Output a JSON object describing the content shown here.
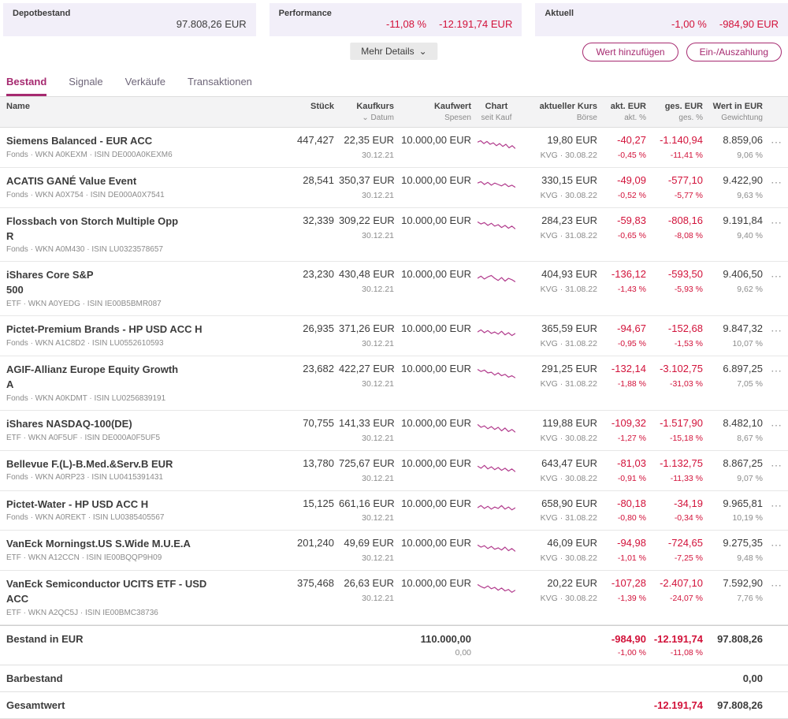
{
  "colors": {
    "accent": "#a62a70",
    "negative": "#d2123a",
    "spark": "#b13a8c",
    "card_bg": "#f2eff9"
  },
  "icons": {
    "caret_down": "⌄",
    "sort_caret": "⌄",
    "row_menu": "⋯"
  },
  "summary": {
    "cards": [
      {
        "label": "Depotbestand",
        "value": "97.808,26 EUR"
      },
      {
        "label": "Performance",
        "pct": "-11,08 %",
        "value": "-12.191,74 EUR"
      },
      {
        "label": "Aktuell",
        "pct": "-1,00 %",
        "value": "-984,90 EUR"
      }
    ]
  },
  "actions": {
    "more_details": "Mehr Details",
    "add_value": "Wert hinzufügen",
    "deposit": "Ein-/Auszahlung"
  },
  "tabs": [
    {
      "label": "Bestand"
    },
    {
      "label": "Signale"
    },
    {
      "label": "Verkäufe"
    },
    {
      "label": "Transaktionen"
    }
  ],
  "table": {
    "headers": {
      "name": "Name",
      "stueck": "Stück",
      "kaufkurs": "Kaufkurs",
      "kaufkurs_sub": "Datum",
      "kaufwert": "Kaufwert",
      "kaufwert_sub": "Spesen",
      "chart": "Chart",
      "chart_sub": "seit Kauf",
      "kurs": "aktueller Kurs",
      "kurs_sub": "Börse",
      "akt": "akt. EUR",
      "akt_sub": "akt. %",
      "ges": "ges. EUR",
      "ges_sub": "ges. %",
      "wert": "Wert in EUR",
      "wert_sub": "Gewichtung"
    },
    "rows": [
      {
        "name": "Siemens Balanced - EUR ACC",
        "meta": "Fonds · WKN A0KEXM · ISIN DE000A0KEXM6",
        "stueck": "447,427",
        "kaufkurs": "22,35 EUR",
        "kaufdatum": "30.12.21",
        "kaufwert": "10.000,00 EUR",
        "kurs": "19,80 EUR",
        "kursmeta": "KVG · 30.08.22",
        "akt": "-40,27",
        "akt_pct": "-0,45 %",
        "ges": "-1.140,94",
        "ges_pct": "-11,41 %",
        "wert": "8.859,06",
        "gew": "9,06 %",
        "spark": [
          0.35,
          0.25,
          0.45,
          0.3,
          0.5,
          0.4,
          0.6,
          0.45,
          0.65,
          0.5,
          0.75,
          0.6,
          0.8
        ]
      },
      {
        "name": "ACATIS GANÉ Value Event",
        "meta": "Fonds · WKN A0X754 · ISIN DE000A0X7541",
        "stueck": "28,541",
        "kaufkurs": "350,37 EUR",
        "kaufdatum": "30.12.21",
        "kaufwert": "10.000,00 EUR",
        "kurs": "330,15 EUR",
        "kursmeta": "KVG · 30.08.22",
        "akt": "-49,09",
        "akt_pct": "-0,52 %",
        "ges": "-577,10",
        "ges_pct": "-5,77 %",
        "wert": "9.422,90",
        "gew": "9,63 %",
        "spark": [
          0.4,
          0.3,
          0.5,
          0.35,
          0.55,
          0.4,
          0.5,
          0.6,
          0.45,
          0.65,
          0.55,
          0.7
        ]
      },
      {
        "name": "Flossbach von Storch Multiple Opp\nR",
        "meta": "Fonds · WKN A0M430 · ISIN LU0323578657",
        "stueck": "32,339",
        "kaufkurs": "309,22 EUR",
        "kaufdatum": "30.12.21",
        "kaufwert": "10.000,00 EUR",
        "kurs": "284,23 EUR",
        "kursmeta": "KVG · 31.08.22",
        "akt": "-59,83",
        "akt_pct": "-0,65 %",
        "ges": "-808,16",
        "ges_pct": "-8,08 %",
        "wert": "9.191,84",
        "gew": "9,40 %",
        "spark": [
          0.3,
          0.45,
          0.35,
          0.55,
          0.4,
          0.6,
          0.5,
          0.7,
          0.55,
          0.75,
          0.6,
          0.8
        ]
      },
      {
        "name": "iShares Core S&P\n500",
        "meta": "ETF · WKN A0YEDG · ISIN IE00B5BMR087",
        "stueck": "23,230",
        "kaufkurs": "430,48 EUR",
        "kaufdatum": "30.12.21",
        "kaufwert": "10.000,00 EUR",
        "kurs": "404,93 EUR",
        "kursmeta": "KVG · 31.08.22",
        "akt": "-136,12",
        "akt_pct": "-1,43 %",
        "ges": "-593,50",
        "ges_pct": "-5,93 %",
        "wert": "9.406,50",
        "gew": "9,62 %",
        "spark": [
          0.5,
          0.35,
          0.55,
          0.4,
          0.3,
          0.5,
          0.65,
          0.45,
          0.7,
          0.5,
          0.6,
          0.75
        ]
      },
      {
        "name": "Pictet-Premium Brands - HP USD ACC H",
        "meta": "Fonds · WKN A1C8D2 · ISIN LU0552610593",
        "stueck": "26,935",
        "kaufkurs": "371,26 EUR",
        "kaufdatum": "30.12.21",
        "kaufwert": "10.000,00 EUR",
        "kurs": "365,59 EUR",
        "kursmeta": "KVG · 31.08.22",
        "akt": "-94,67",
        "akt_pct": "-0,95 %",
        "ges": "-152,68",
        "ges_pct": "-1,53 %",
        "wert": "9.847,32",
        "gew": "10,07 %",
        "spark": [
          0.45,
          0.3,
          0.5,
          0.35,
          0.55,
          0.45,
          0.6,
          0.4,
          0.65,
          0.5,
          0.7,
          0.55
        ]
      },
      {
        "name": "AGIF-Allianz Europe Equity Growth\nA",
        "meta": "Fonds · WKN A0KDMT · ISIN LU0256839191",
        "stueck": "23,682",
        "kaufkurs": "422,27 EUR",
        "kaufdatum": "30.12.21",
        "kaufwert": "10.000,00 EUR",
        "kurs": "291,25 EUR",
        "kursmeta": "KVG · 31.08.22",
        "akt": "-132,14",
        "akt_pct": "-1,88 %",
        "ges": "-3.102,75",
        "ges_pct": "-31,03 %",
        "wert": "6.897,25",
        "gew": "7,05 %",
        "spark": [
          0.25,
          0.4,
          0.3,
          0.5,
          0.45,
          0.65,
          0.5,
          0.7,
          0.6,
          0.8,
          0.7,
          0.85
        ]
      },
      {
        "name": "iShares NASDAQ-100(DE)",
        "meta": "ETF · WKN A0F5UF · ISIN DE000A0F5UF5",
        "stueck": "70,755",
        "kaufkurs": "141,33 EUR",
        "kaufdatum": "30.12.21",
        "kaufwert": "10.000,00 EUR",
        "kurs": "119,88 EUR",
        "kursmeta": "KVG · 30.08.22",
        "akt": "-109,32",
        "akt_pct": "-1,27 %",
        "ges": "-1.517,90",
        "ges_pct": "-15,18 %",
        "wert": "8.482,10",
        "gew": "8,67 %",
        "spark": [
          0.3,
          0.5,
          0.4,
          0.6,
          0.45,
          0.65,
          0.5,
          0.75,
          0.55,
          0.8,
          0.65,
          0.85
        ]
      },
      {
        "name": "Bellevue F.(L)-B.Med.&Serv.B EUR",
        "meta": "Fonds · WKN A0RP23 · ISIN LU0415391431",
        "stueck": "13,780",
        "kaufkurs": "725,67 EUR",
        "kaufdatum": "30.12.21",
        "kaufwert": "10.000,00 EUR",
        "kurs": "643,47 EUR",
        "kursmeta": "KVG · 30.08.22",
        "akt": "-81,03",
        "akt_pct": "-0,91 %",
        "ges": "-1.132,75",
        "ges_pct": "-11,33 %",
        "wert": "8.867,25",
        "gew": "9,07 %",
        "spark": [
          0.4,
          0.55,
          0.35,
          0.6,
          0.45,
          0.65,
          0.5,
          0.7,
          0.55,
          0.75,
          0.6,
          0.8
        ]
      },
      {
        "name": "Pictet-Water - HP USD ACC H",
        "meta": "Fonds · WKN A0REKT · ISIN LU0385405567",
        "stueck": "15,125",
        "kaufkurs": "661,16 EUR",
        "kaufdatum": "30.12.21",
        "kaufwert": "10.000,00 EUR",
        "kurs": "658,90 EUR",
        "kursmeta": "KVG · 31.08.22",
        "akt": "-80,18",
        "akt_pct": "-0,80 %",
        "ges": "-34,19",
        "ges_pct": "-0,34 %",
        "wert": "9.965,81",
        "gew": "10,19 %",
        "spark": [
          0.5,
          0.35,
          0.55,
          0.4,
          0.6,
          0.45,
          0.55,
          0.35,
          0.6,
          0.45,
          0.65,
          0.5
        ]
      },
      {
        "name": "VanEck Morningst.US S.Wide M.U.E.A",
        "meta": "ETF · WKN A12CCN · ISIN IE00BQQP9H09",
        "stueck": "201,240",
        "kaufkurs": "49,69 EUR",
        "kaufdatum": "30.12.21",
        "kaufwert": "10.000,00 EUR",
        "kurs": "46,09 EUR",
        "kursmeta": "KVG · 30.08.22",
        "akt": "-94,98",
        "akt_pct": "-1,01 %",
        "ges": "-724,65",
        "ges_pct": "-7,25 %",
        "wert": "9.275,35",
        "gew": "9,48 %",
        "spark": [
          0.35,
          0.5,
          0.4,
          0.6,
          0.45,
          0.65,
          0.55,
          0.7,
          0.5,
          0.75,
          0.6,
          0.8
        ]
      },
      {
        "name": "VanEck Semiconductor UCITS ETF - USD\nACC",
        "meta": "ETF · WKN A2QC5J · ISIN IE00BMC38736",
        "stueck": "375,468",
        "kaufkurs": "26,63 EUR",
        "kaufdatum": "30.12.21",
        "kaufwert": "10.000,00 EUR",
        "kurs": "20,22 EUR",
        "kursmeta": "KVG · 30.08.22",
        "akt": "-107,28",
        "akt_pct": "-1,39 %",
        "ges": "-2.407,10",
        "ges_pct": "-24,07 %",
        "wert": "7.592,90",
        "gew": "7,76 %",
        "spark": [
          0.3,
          0.45,
          0.55,
          0.4,
          0.6,
          0.5,
          0.7,
          0.55,
          0.75,
          0.65,
          0.85,
          0.7
        ]
      }
    ],
    "footer": {
      "bestand": {
        "label": "Bestand in EUR",
        "kaufwert": "110.000,00",
        "spesen": "0,00",
        "akt": "-984,90",
        "akt_pct": "-1,00 %",
        "ges": "-12.191,74",
        "ges_pct": "-11,08 %",
        "wert": "97.808,26"
      },
      "barbestand": {
        "label": "Barbestand",
        "wert": "0,00"
      },
      "gesamtwert": {
        "label": "Gesamtwert",
        "ges": "-12.191,74",
        "wert": "97.808,26"
      }
    }
  }
}
